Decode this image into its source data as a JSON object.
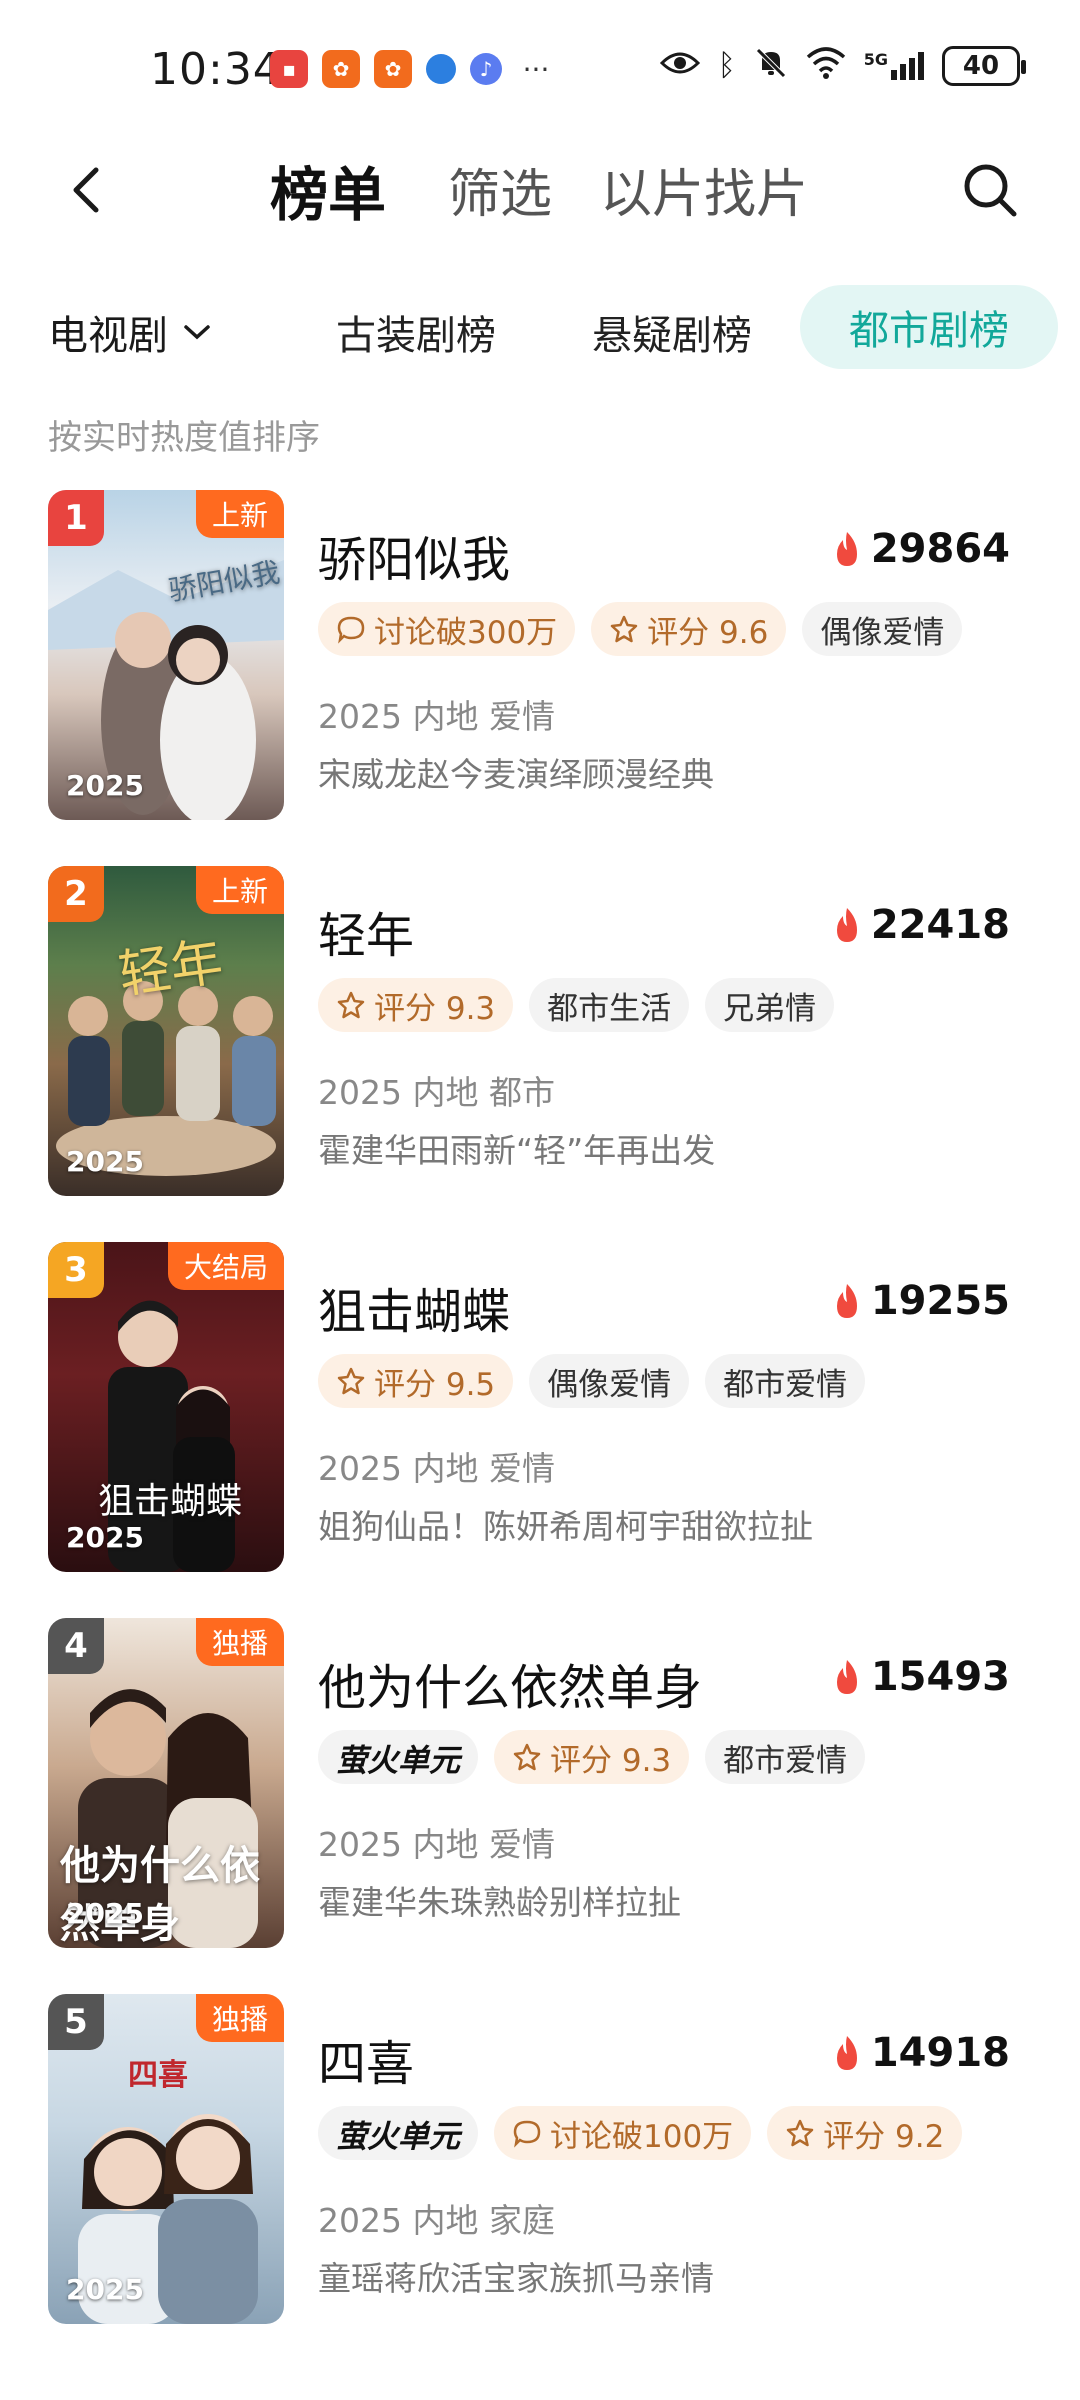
{
  "status_bar": {
    "time": "10:34",
    "battery": "40",
    "network": "5G",
    "notif_icons": [
      "huawei-app-icon",
      "app-icon",
      "app-icon",
      "browser-icon",
      "music-icon"
    ],
    "more": "···"
  },
  "header": {
    "tabs": [
      "榜单",
      "筛选",
      "以片找片"
    ]
  },
  "categories": {
    "dropdown": "电视剧",
    "tabs": [
      "古装剧榜",
      "悬疑剧榜",
      "都市剧榜"
    ]
  },
  "sort_hint": "按实时热度值排序",
  "colors": {
    "accent": "#12a89a",
    "rank1": "#e8443f",
    "rank2": "#f26b1d",
    "rank3": "#f5a623",
    "rank_other": "#555555",
    "badge": "#ff6a1f",
    "heat": "#f04a3e"
  },
  "items": [
    {
      "rank": "1",
      "badge": "上新",
      "year": "2025",
      "title": "骄阳似我",
      "heat": "29864",
      "tags": [
        {
          "text": "讨论破300万",
          "icon": "comment-icon",
          "style": "warm"
        },
        {
          "text": "评分 9.6",
          "icon": "star-icon",
          "style": "warm"
        },
        {
          "text": "偶像爱情",
          "icon": "",
          "style": "plain"
        }
      ],
      "meta": "2025 内地 爱情",
      "desc": "宋威龙赵今麦演绎顾漫经典"
    },
    {
      "rank": "2",
      "badge": "上新",
      "year": "2025",
      "title": "轻年",
      "heat": "22418",
      "tags": [
        {
          "text": "评分 9.3",
          "icon": "star-icon",
          "style": "warm"
        },
        {
          "text": "都市生活",
          "icon": "",
          "style": "plain"
        },
        {
          "text": "兄弟情",
          "icon": "",
          "style": "plain"
        }
      ],
      "meta": "2025 内地 都市",
      "desc": "霍建华田雨新“轻”年再出发"
    },
    {
      "rank": "3",
      "badge": "大结局",
      "year": "2025",
      "title": "狙击蝴蝶",
      "heat": "19255",
      "tags": [
        {
          "text": "评分 9.5",
          "icon": "star-icon",
          "style": "warm"
        },
        {
          "text": "偶像爱情",
          "icon": "",
          "style": "plain"
        },
        {
          "text": "都市爱情",
          "icon": "",
          "style": "plain"
        }
      ],
      "meta": "2025 内地 爱情",
      "desc": "姐狗仙品！陈妍希周柯宇甜欲拉扯"
    },
    {
      "rank": "4",
      "badge": "独播",
      "year": "2025",
      "title": "他为什么依然单身",
      "heat": "15493",
      "tags": [
        {
          "text": "萤火单元",
          "icon": "",
          "style": "firefly"
        },
        {
          "text": "评分 9.3",
          "icon": "star-icon",
          "style": "warm"
        },
        {
          "text": "都市爱情",
          "icon": "",
          "style": "plain"
        }
      ],
      "meta": "2025 内地 爱情",
      "desc": "霍建华朱珠熟龄别样拉扯"
    },
    {
      "rank": "5",
      "badge": "独播",
      "year": "2025",
      "title": "四喜",
      "heat": "14918",
      "tags": [
        {
          "text": "萤火单元",
          "icon": "",
          "style": "firefly"
        },
        {
          "text": "讨论破100万",
          "icon": "comment-icon",
          "style": "warm"
        },
        {
          "text": "评分 9.2",
          "icon": "star-icon",
          "style": "warm"
        }
      ],
      "meta": "2025 内地 家庭",
      "desc": "童瑶蒋欣活宝家族抓马亲情"
    }
  ]
}
